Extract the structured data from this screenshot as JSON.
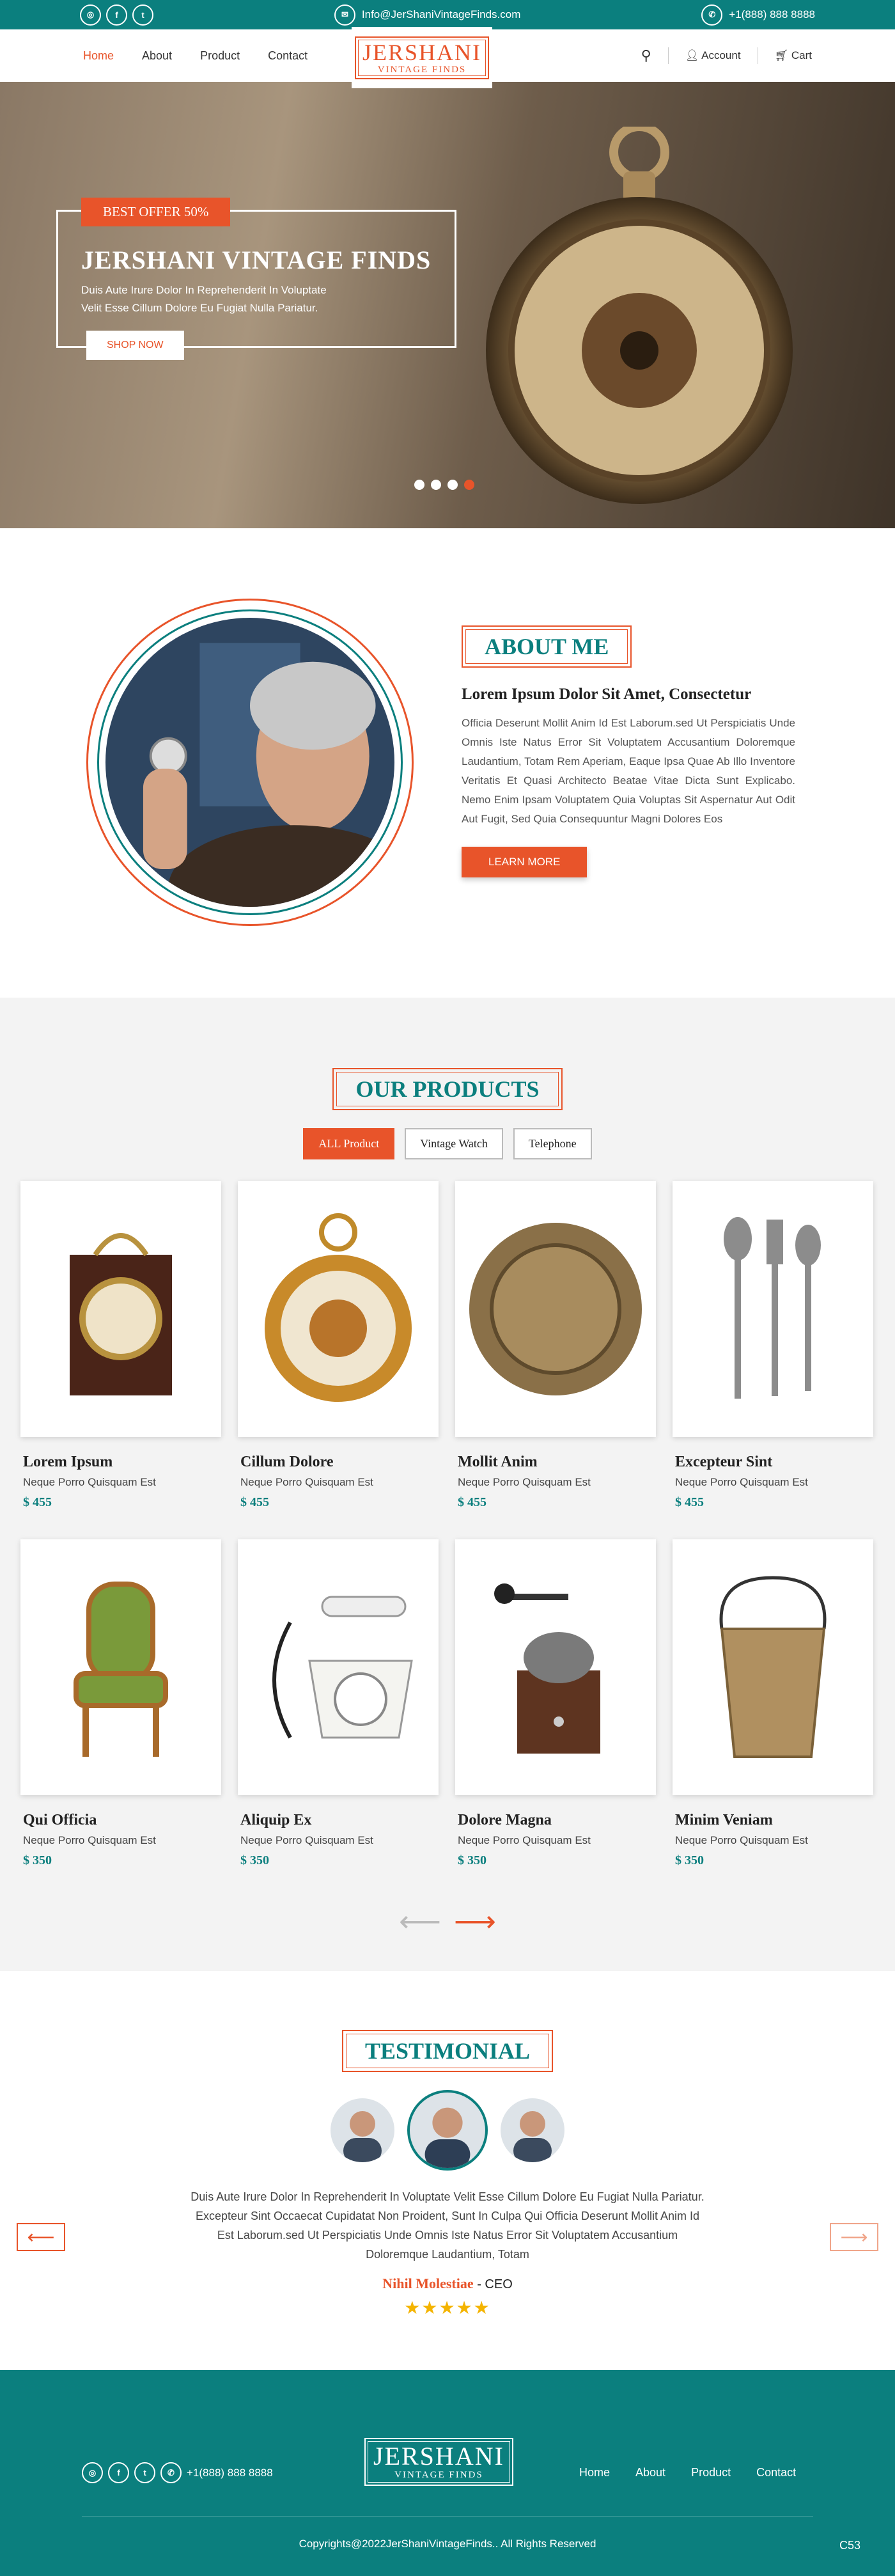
{
  "topbar": {
    "email": "Info@JerShaniVintageFinds.com",
    "phone": "+1(888) 888 8888",
    "social": [
      "instagram-icon",
      "facebook-icon",
      "twitter-icon"
    ]
  },
  "nav": {
    "links": [
      "Home",
      "About",
      "Product",
      "Contact"
    ],
    "account": "Account",
    "cart": "Cart"
  },
  "logo": {
    "line1": "JERSHANI",
    "line2": "VINTAGE FINDS"
  },
  "hero": {
    "offer": "BEST OFFER 50%",
    "title": "JERSHANI VINTAGE FINDS",
    "text1": "Duis Aute Irure Dolor In Reprehenderit In Voluptate",
    "text2": "Velit Esse Cillum Dolore Eu Fugiat Nulla Pariatur.",
    "cta": "SHOP NOW"
  },
  "about": {
    "title": "ABOUT ME",
    "heading": "Lorem Ipsum Dolor Sit Amet, Consectetur",
    "body": "Officia Deserunt Mollit Anim Id Est Laborum.sed Ut Perspiciatis Unde Omnis Iste Natus Error Sit Voluptatem Accusantium Doloremque Laudantium, Totam Rem Aperiam, Eaque Ipsa Quae Ab Illo Inventore Veritatis Et Quasi Architecto Beatae Vitae Dicta Sunt Explicabo. Nemo Enim Ipsam Voluptatem Quia Voluptas Sit Aspernatur Aut Odit Aut Fugit, Sed Quia Consequuntur Magni Dolores Eos",
    "cta": "LEARN MORE"
  },
  "products": {
    "title": "OUR PRODUCTS",
    "filters": [
      "ALL Product",
      "Vintage Watch",
      "Telephone"
    ],
    "items": [
      {
        "name": "Lorem Ipsum",
        "desc": "Neque Porro Quisquam Est",
        "price": "$ 455"
      },
      {
        "name": "Cillum Dolore",
        "desc": "Neque Porro Quisquam Est",
        "price": "$ 455"
      },
      {
        "name": "Mollit Anim",
        "desc": "Neque Porro Quisquam Est",
        "price": "$ 455"
      },
      {
        "name": "Excepteur Sint",
        "desc": "Neque Porro Quisquam Est",
        "price": "$ 455"
      },
      {
        "name": "Qui Officia",
        "desc": "Neque Porro Quisquam Est",
        "price": "$ 350"
      },
      {
        "name": "Aliquip Ex",
        "desc": "Neque Porro Quisquam Est",
        "price": "$ 350"
      },
      {
        "name": "Dolore Magna",
        "desc": "Neque Porro Quisquam Est",
        "price": "$ 350"
      },
      {
        "name": "Minim Veniam",
        "desc": "Neque Porro Quisquam Est",
        "price": "$ 350"
      }
    ]
  },
  "testimonial": {
    "title": "TESTIMONIAL",
    "quote": "Duis Aute Irure Dolor In Reprehenderit In Voluptate Velit Esse Cillum Dolore Eu Fugiat Nulla Pariatur. Excepteur Sint Occaecat Cupidatat Non Proident, Sunt In Culpa Qui Officia Deserunt Mollit Anim Id Est Laborum.sed Ut Perspiciatis Unde Omnis Iste Natus Error Sit Voluptatem Accusantium Doloremque Laudantium, Totam",
    "name": "Nihil Molestiae",
    "role": "- CEO",
    "stars": "★★★★★"
  },
  "footer": {
    "phone": "+1(888) 888 8888",
    "links": [
      "Home",
      "About",
      "Product",
      "Contact"
    ],
    "copyright": "Copyrights@2022JerShaniVintageFinds.. All Rights Reserved",
    "badge": "C53"
  },
  "colors": {
    "teal": "#0b7f7e",
    "orange": "#e8542a"
  }
}
